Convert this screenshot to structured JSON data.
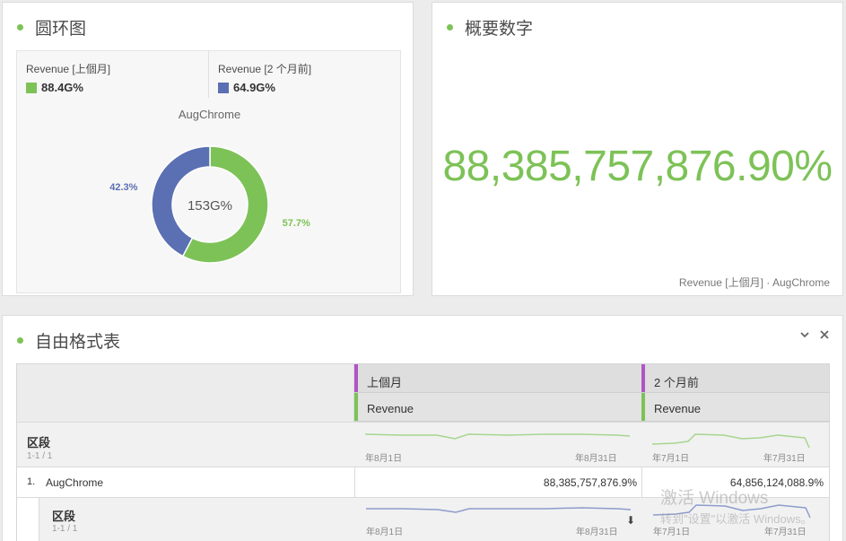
{
  "donut_panel": {
    "title": "圆环图",
    "legend": [
      {
        "label": "Revenue [上個月]",
        "value": "88.4G%",
        "color": "#7dc257"
      },
      {
        "label": "Revenue [2 个月前]",
        "value": "64.9G%",
        "color": "#5b6fb3"
      }
    ],
    "segment_label": "AugChrome",
    "center_label": "153G%"
  },
  "chart_data": {
    "type": "pie",
    "categories": [
      "Revenue [上個月]",
      "Revenue [2 个月前]"
    ],
    "values": [
      57.7,
      42.3
    ],
    "slice_labels": [
      "57.7%",
      "42.3%"
    ],
    "colors": [
      "#7dc257",
      "#5b6fb3"
    ]
  },
  "summary_panel": {
    "title": "概要数字",
    "value": "88,385,757,876.90%",
    "footer": "Revenue [上個月] · AugChrome"
  },
  "table_panel": {
    "title": "自由格式表",
    "collapse_icon": "chevron-down-icon",
    "close_icon": "close-icon",
    "columns": [
      {
        "period": "上個月",
        "metric": "Revenue"
      },
      {
        "period": "2 个月前",
        "metric": "Revenue"
      }
    ],
    "segment_header": {
      "name": "区段",
      "range": "1-1 / 1"
    },
    "spark_dates": [
      {
        "start": "年8月1日",
        "end": "年8月31日"
      },
      {
        "start": "年7月1日",
        "end": "年7月31日"
      }
    ],
    "rows": [
      {
        "index": "1.",
        "name": "AugChrome",
        "values": [
          "88,385,757,876.9%",
          "64,856,124,088.9%"
        ]
      }
    ],
    "sub_segment": {
      "name": "区段",
      "range": "1-1 / 1"
    }
  },
  "watermark": {
    "line1": "激活 Windows",
    "line2": "转到\"设置\"以激活 Windows。"
  }
}
